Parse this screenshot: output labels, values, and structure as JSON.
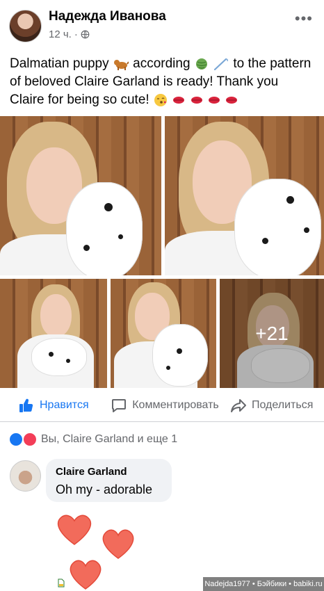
{
  "post": {
    "author": "Надежда Иванова",
    "time": "12 ч.",
    "more_icon": "more-dots-icon",
    "text_part1": "Dalmatian puppy",
    "text_part2": " according",
    "text_part3": " to the pattern of beloved Claire Garland is ready! Thank you Claire for being so cute! ",
    "extra_photos": "+21"
  },
  "actions": {
    "like": "Нравится",
    "comment": "Комментировать",
    "share": "Поделиться"
  },
  "reactions": {
    "summary": "Вы, Claire Garland и еще 1"
  },
  "comment": {
    "author": "Claire Garland",
    "text": "Oh my - adorable"
  },
  "watermark": "Nadejda1977 • Бэйбики • babiki.ru",
  "colors": {
    "accent": "#1877f2",
    "secondary_text": "#65676b",
    "bubble": "#f0f2f5",
    "heart": "#f26b5b"
  }
}
